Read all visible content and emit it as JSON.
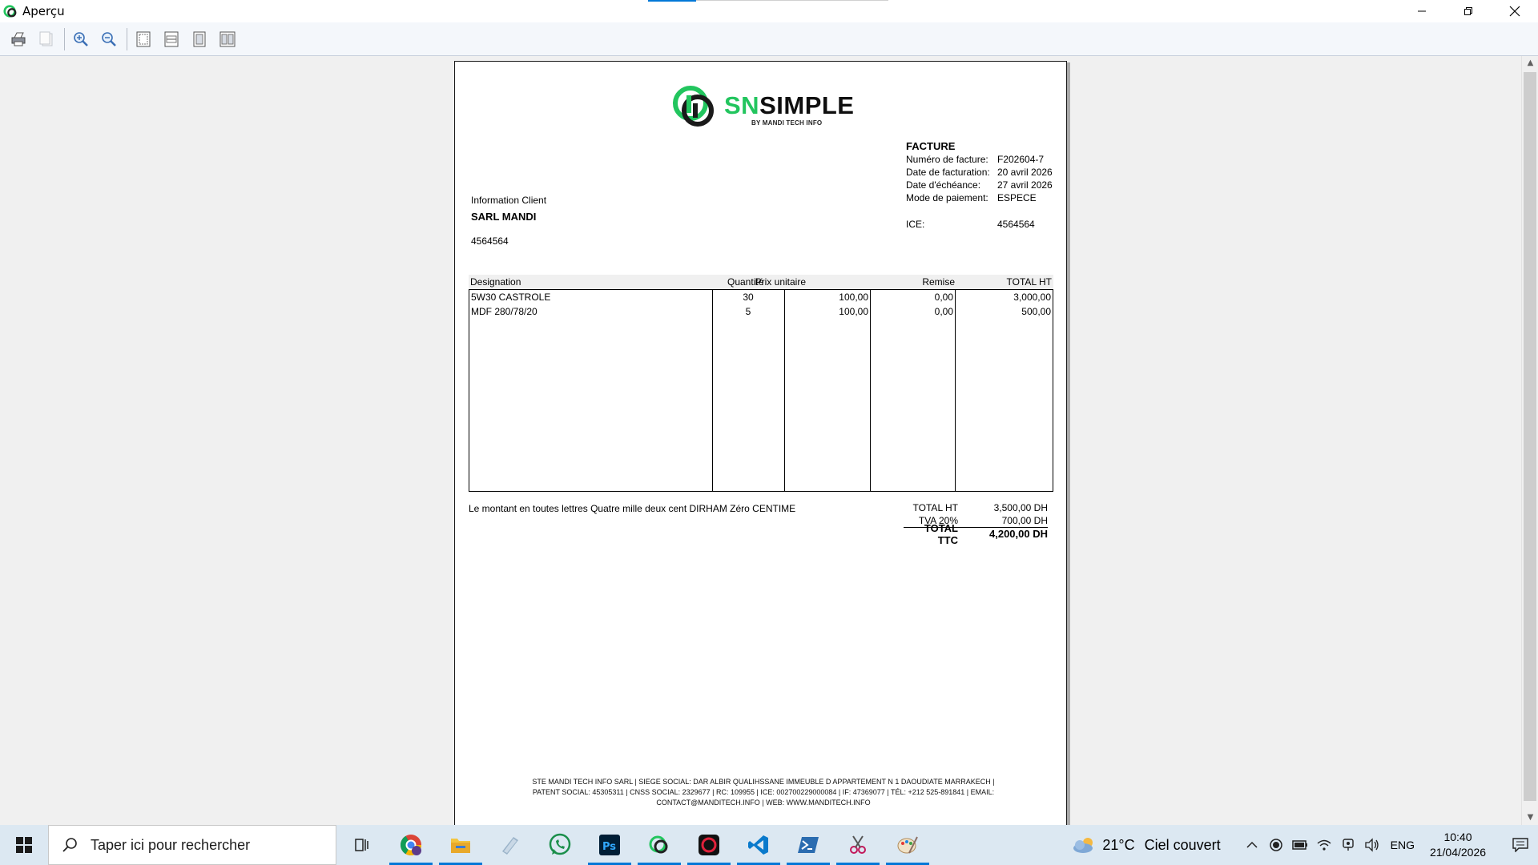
{
  "window": {
    "title": "Aperçu"
  },
  "logo": {
    "sn": "SN",
    "rest": "SIMPLE",
    "sub": "BY MANDI TECH INFO"
  },
  "invoice": {
    "heading": "FACTURE",
    "number_label": "Numéro de facture:",
    "number": "F202604-7",
    "date_label": "Date de facturation:",
    "date": "20 avril 2026",
    "due_label": "Date d'échéance:",
    "due": "27 avril 2026",
    "payment_label": "Mode de paiement:",
    "payment": "ESPECE",
    "ice_label": "ICE:",
    "ice": "4564564"
  },
  "client": {
    "label": "Information Client",
    "name": "SARL MANDI",
    "number": "4564564"
  },
  "table": {
    "headers": [
      "Designation",
      "Quantité",
      "Prix unitaire",
      "Remise",
      "TOTAL HT"
    ],
    "rows": [
      [
        "5W30 CASTROLE",
        "30",
        "100,00",
        "0,00",
        "3,000,00"
      ],
      [
        "MDF 280/78/20",
        "5",
        "100,00",
        "0,00",
        "500,00"
      ]
    ]
  },
  "amount_words": "Le montant en toutes lettres Quatre mille deux cent DIRHAM Zéro CENTIME",
  "totals": {
    "ht_label": "TOTAL HT",
    "ht": "3,500,00 DH",
    "tva_label": "TVA  20%",
    "tva": "700,00 DH",
    "ttc_label": "TOTAL TTC",
    "ttc": "4,200,00 DH"
  },
  "footer": {
    "line1": "STE MANDI TECH INFO SARL | SIEGE SOCIAL: DAR ALBIR QUALIHSSANE IMMEUBLE D APPARTEMENT N 1 DAOUDIATE MARRAKECH |",
    "line2": "PATENT SOCIAL: 45305311 | CNSS SOCIAL: 2329677 | RC: 109955 | ICE: 002700229000084 | IF: 47369077 | TÉL: +212 525-891841 | EMAIL:",
    "line3": "CONTACT@MANDITECH.INFO | WEB: WWW.MANDITECH.INFO"
  },
  "taskbar": {
    "search_placeholder": "Taper ici pour rechercher",
    "temperature": "21°C",
    "weather": "Ciel couvert",
    "lang": "ENG",
    "time": "10:40",
    "date": "21/04/2026"
  },
  "colors": {
    "brand_green": "#22c55e",
    "taskbar": "#dce8f2",
    "accent": "#0078d7"
  }
}
